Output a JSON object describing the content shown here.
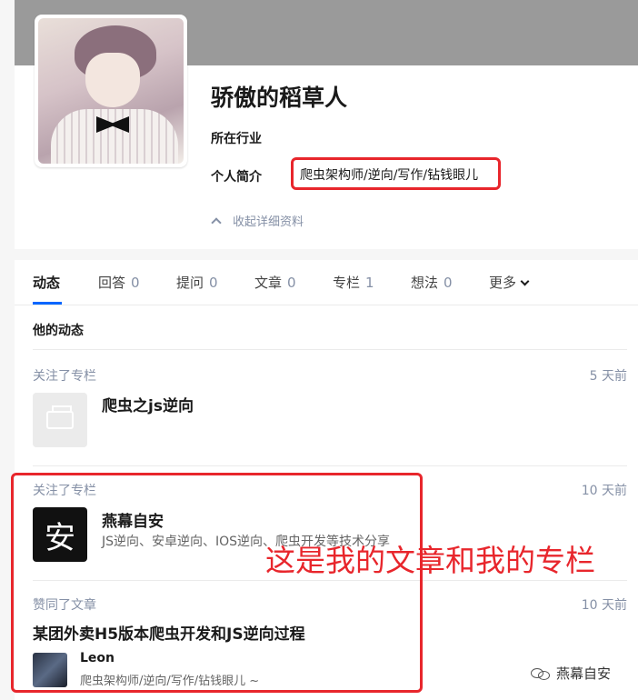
{
  "profile": {
    "name": "骄傲的稻草人",
    "industry_label": "所在行业",
    "bio_label": "个人简介",
    "bio_value": "爬虫架构师/逆向/写作/钻钱眼儿",
    "collapse_label": "收起详细资料"
  },
  "tabs": [
    {
      "label": "动态",
      "count": ""
    },
    {
      "label": "回答",
      "count": "0"
    },
    {
      "label": "提问",
      "count": "0"
    },
    {
      "label": "文章",
      "count": "0"
    },
    {
      "label": "专栏",
      "count": "1"
    },
    {
      "label": "想法",
      "count": "0"
    },
    {
      "label": "更多",
      "count": ""
    }
  ],
  "section_title": "他的动态",
  "feed": [
    {
      "action": "关注了专栏",
      "time": "5 天前",
      "title": "爬虫之js逆向",
      "thumb_icon": "typewriter-icon"
    },
    {
      "action": "关注了专栏",
      "time": "10 天前",
      "title": "燕幕自安",
      "desc": "JS逆向、安卓逆向、IOS逆向、爬虫开发等技术分享",
      "thumb_text": "安"
    },
    {
      "action": "赞同了文章",
      "time": "10 天前",
      "title": "某团外卖H5版本爬虫开发和JS逆向过程",
      "author": "Leon",
      "author_bio": "爬虫架构师/逆向/写作/钻钱眼儿 ~"
    }
  ],
  "annotation": "这是我的文章和我的专栏",
  "watermark": "燕幕自安",
  "colors": {
    "accent": "#0066ff",
    "highlight_red": "#e8262c",
    "meta_gray": "#8590a6"
  }
}
